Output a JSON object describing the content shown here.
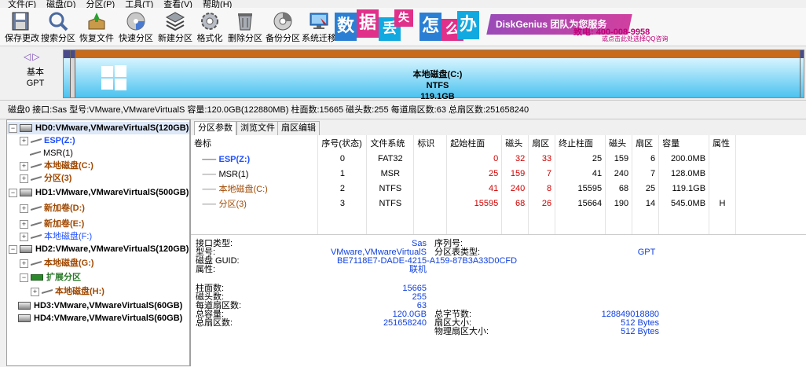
{
  "menu": [
    "文件(F)",
    "磁盘(D)",
    "分区(P)",
    "工具(T)",
    "查看(V)",
    "帮助(H)"
  ],
  "toolbar": {
    "save": "保存更改",
    "search": "搜索分区",
    "recover": "恢复文件",
    "quick": "快速分区",
    "new": "新建分区",
    "format": "格式化",
    "delete": "删除分区",
    "backup": "备份分区",
    "migrate": "系统迁移"
  },
  "banner": {
    "tiles": [
      "数",
      "据",
      "丢",
      "失",
      "怎",
      "么",
      "办"
    ],
    "brand": "DiskGenius 团队为您服务",
    "team": "团队为您服务",
    "phone": "致电: 400-008-9958",
    "qq": "或点击此处选择QQ咨询",
    "colors": {
      "blue": "#2a7fd4",
      "pink": "#e0308a",
      "cyan": "#12a9e0",
      "purple": "#8a3fb0"
    }
  },
  "disk": {
    "type_line1": "基本",
    "type_line2": "GPT",
    "c_label": "本地磁盘(C:)",
    "c_fs": "NTFS",
    "c_size": "119.1GB",
    "nav": "◁▷"
  },
  "statusline": "磁盘0 接口:Sas  型号:VMware,VMwareVirtualS  容量:120.0GB(122880MB)  柱面数:15665  磁头数:255  每道扇区数:63  总扇区数:251658240",
  "tree": {
    "hd0": "HD0:VMware,VMwareVirtualS(120GB)",
    "esp": "ESP(Z:)",
    "msr": "MSR(1)",
    "c": "本地磁盘(C:)",
    "p3": "分区(3)",
    "hd1": "HD1:VMware,VMwareVirtualS(500GB)",
    "d": "新加卷(D:)",
    "e": "新加卷(E:)",
    "f": "本地磁盘(F:)",
    "hd2": "HD2:VMware,VMwareVirtualS(120GB)",
    "g": "本地磁盘(G:)",
    "ext": "扩展分区",
    "h": "本地磁盘(H:)",
    "hd3": "HD3:VMware,VMwareVirtualS(60GB)",
    "hd4": "HD4:VMware,VMwareVirtualS(60GB)"
  },
  "tabs": [
    "分区参数",
    "浏览文件",
    "扇区编辑"
  ],
  "table": {
    "headers": [
      "卷标",
      "序号(状态)",
      "文件系统",
      "标识",
      "起始柱面",
      "磁头",
      "扇区",
      "终止柱面",
      "磁头",
      "扇区",
      "容量",
      "属性"
    ],
    "rows": [
      {
        "label": "ESP(Z:)",
        "seq": "0",
        "fs": "FAT32",
        "id": "",
        "sc": "0",
        "sh": "32",
        "ss": "33",
        "ec": "25",
        "eh": "159",
        "es": "6",
        "cap": "200.0MB",
        "attr": ""
      },
      {
        "label": "MSR(1)",
        "seq": "1",
        "fs": "MSR",
        "id": "",
        "sc": "25",
        "sh": "159",
        "ss": "7",
        "ec": "41",
        "eh": "240",
        "es": "7",
        "cap": "128.0MB",
        "attr": ""
      },
      {
        "label": "本地磁盘(C:)",
        "seq": "2",
        "fs": "NTFS",
        "id": "",
        "sc": "41",
        "sh": "240",
        "ss": "8",
        "ec": "15595",
        "eh": "68",
        "es": "25",
        "cap": "119.1GB",
        "attr": ""
      },
      {
        "label": "分区(3)",
        "seq": "3",
        "fs": "NTFS",
        "id": "",
        "sc": "15595",
        "sh": "68",
        "ss": "26",
        "ec": "15664",
        "eh": "190",
        "es": "14",
        "cap": "545.0MB",
        "attr": "H"
      }
    ]
  },
  "info": {
    "iface_label": "接口类型:",
    "iface": "Sas",
    "model_label": "型号:",
    "model": "VMware,VMwareVirtualS",
    "guid_label": "磁盘 GUID:",
    "guid": "BE7118E7-DADE-4215-A159-87B3A33D0CFD",
    "attr_label": "属性:",
    "attr": "联机",
    "sn_label": "序列号:",
    "pt_label": "分区表类型:",
    "pt": "GPT",
    "cyl_label": "柱面数:",
    "cyl": "15665",
    "heads_label": "磁头数:",
    "heads": "255",
    "spt_label": "每道扇区数:",
    "spt": "63",
    "cap_label": "总容量:",
    "cap": "120.0GB",
    "ts_label": "总扇区数:",
    "ts": "251658240",
    "bytes_label": "总字节数:",
    "bytes": "128849018880",
    "ss_label": "扇区大小:",
    "ss": "512 Bytes",
    "pss_label": "物理扇区大小:",
    "pss": "512 Bytes"
  }
}
